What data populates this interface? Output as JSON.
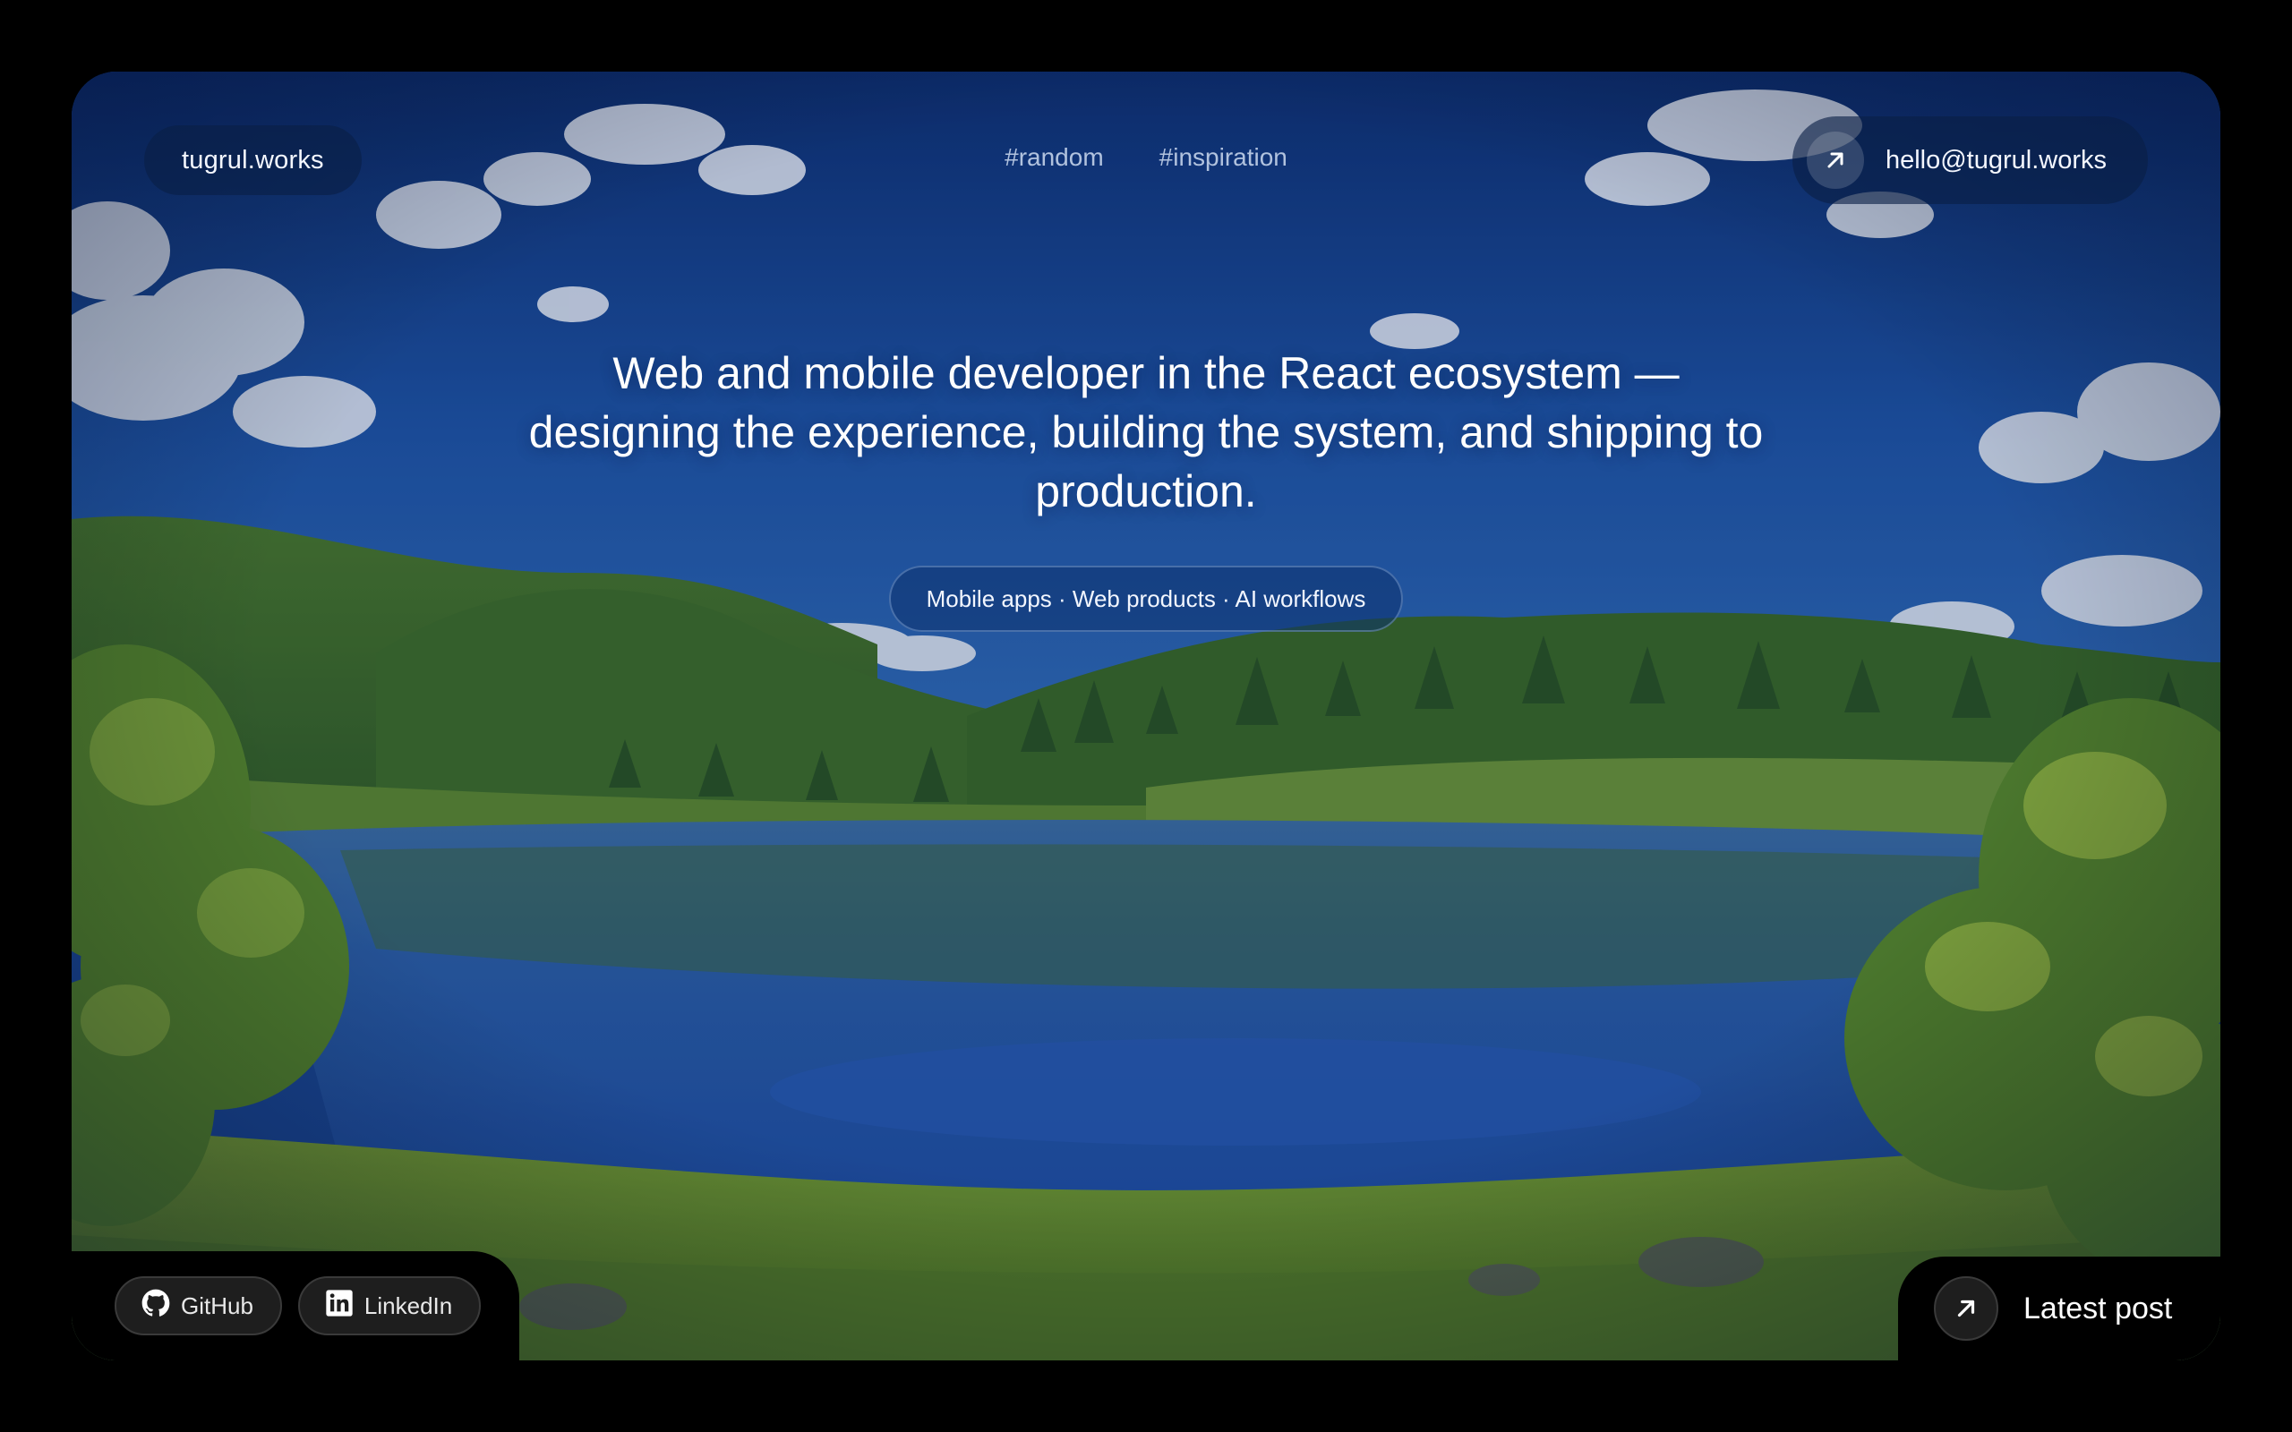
{
  "brand": {
    "label": "tugrul.works"
  },
  "nav": {
    "tags": [
      {
        "label": "#random"
      },
      {
        "label": "#inspiration"
      }
    ]
  },
  "contact": {
    "email": "hello@tugrul.works",
    "icon": "arrow-up-right-icon"
  },
  "hero": {
    "headline": "Web and mobile developer in the React ecosystem — designing the experience, building the system, and shipping to production.",
    "services": "Mobile apps · Web products · AI workflows"
  },
  "social": {
    "links": [
      {
        "label": "GitHub",
        "icon": "github-icon"
      },
      {
        "label": "LinkedIn",
        "icon": "linkedin-icon"
      }
    ]
  },
  "latest_post": {
    "label": "Latest post",
    "icon": "arrow-up-right-icon"
  },
  "colors": {
    "page_background": "#000000",
    "sky": "#1b4a9a",
    "grass": "#6f9a2c",
    "lake": "#2255b0",
    "pill_background": "#0a1e46"
  }
}
